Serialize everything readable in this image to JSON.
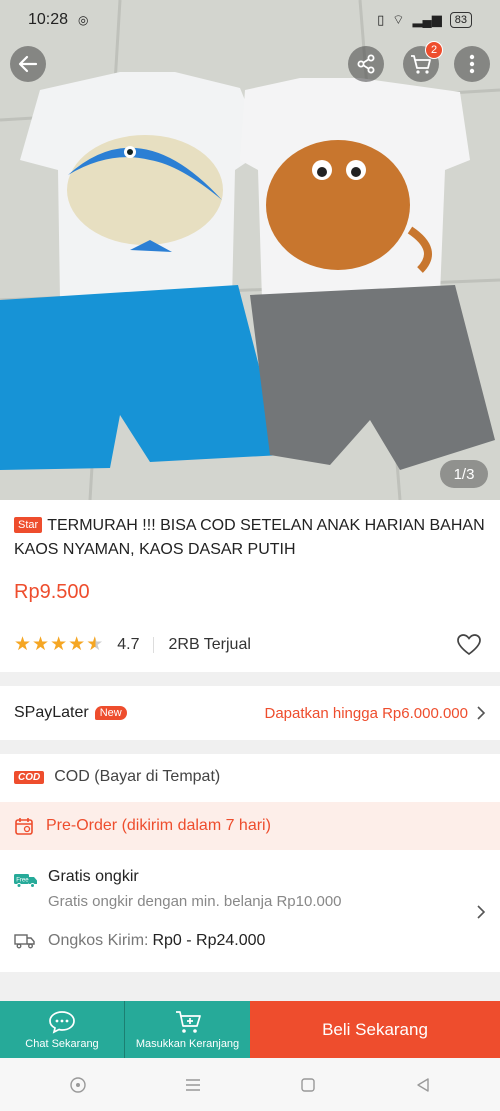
{
  "status_bar": {
    "time": "10:28",
    "battery": "83"
  },
  "header": {
    "cart_count": "2",
    "image_counter": "1/3"
  },
  "product": {
    "tag": "Star",
    "title": "TERMURAH !!! BISA COD SETELAN ANAK HARIAN BAHAN KAOS NYAMAN, KAOS DASAR PUTIH",
    "price": "Rp9.500",
    "rating": "4.7",
    "rating_fraction": 0.94,
    "sold": "2RB Terjual"
  },
  "spaylater": {
    "label": "SPayLater",
    "badge": "New",
    "offer": "Dapatkan hingga Rp6.000.000"
  },
  "shipping": {
    "cod_icon": "COD",
    "cod_label": "COD (Bayar di Tempat)",
    "preorder_label": "Pre-Order (dikirim dalam 7 hari)",
    "free_icon_text": "Free",
    "free_title": "Gratis ongkir",
    "free_subtitle": "Gratis ongkir dengan min. belanja Rp10.000",
    "cost_label": "Ongkos Kirim:",
    "cost_value": "Rp0 - Rp24.000"
  },
  "actions": {
    "chat_label": "Chat Sekarang",
    "cart_label": "Masukkan Keranjang",
    "buy_label": "Beli Sekarang"
  },
  "colors": {
    "brand": "#ee4d2d",
    "teal": "#26aa99",
    "star": "#f5a623"
  }
}
